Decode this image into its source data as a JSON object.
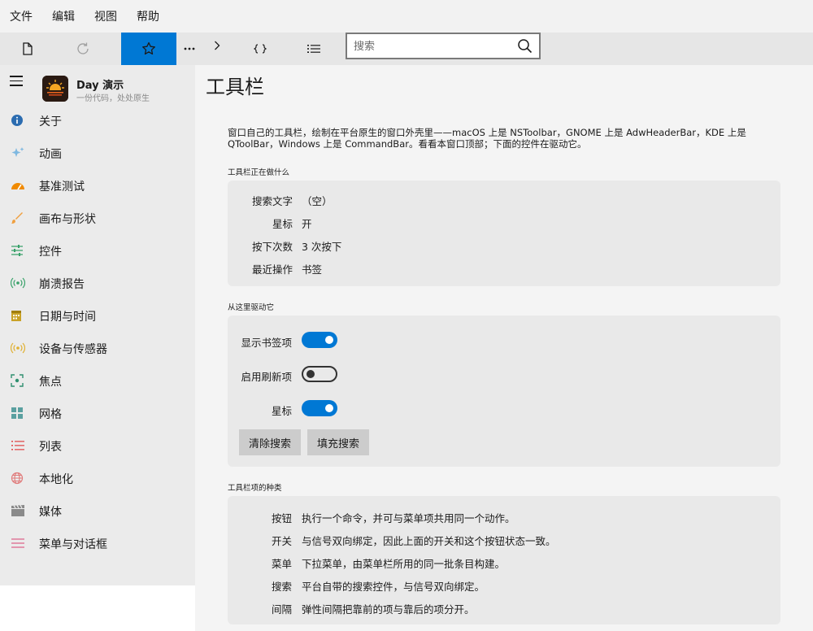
{
  "menu": [
    "文件",
    "编辑",
    "视图",
    "帮助"
  ],
  "search": {
    "placeholder": "搜索",
    "value": ""
  },
  "app": {
    "name": "Day 演示",
    "subtitle": "一份代码，处处原生"
  },
  "nav": [
    {
      "label": "关于",
      "icon": "info-icon",
      "color": "#2b6cb0"
    },
    {
      "label": "动画",
      "icon": "sparkle-icon",
      "color": "#7fb8e0"
    },
    {
      "label": "基准测试",
      "icon": "gauge-icon",
      "color": "#f08a00"
    },
    {
      "label": "画布与形状",
      "icon": "brush-icon",
      "color": "#f0a040"
    },
    {
      "label": "控件",
      "icon": "sliders-icon",
      "color": "#38a169"
    },
    {
      "label": "崩溃报告",
      "icon": "broadcast-icon",
      "color": "#38a169"
    },
    {
      "label": "日期与时间",
      "icon": "calendar-icon",
      "color": "#c9a227"
    },
    {
      "label": "设备与传感器",
      "icon": "sensor-icon",
      "color": "#e0b030"
    },
    {
      "label": "焦点",
      "icon": "focus-icon",
      "color": "#2f8f6f"
    },
    {
      "label": "网格",
      "icon": "grid-icon",
      "color": "#5aa0a0"
    },
    {
      "label": "列表",
      "icon": "list-icon",
      "color": "#e05050"
    },
    {
      "label": "本地化",
      "icon": "globe-icon",
      "color": "#e07a7a"
    },
    {
      "label": "媒体",
      "icon": "clapper-icon",
      "color": "#8a8a8a"
    },
    {
      "label": "菜单与对话框",
      "icon": "menu-lines-icon",
      "color": "#e07a9a"
    }
  ],
  "main": {
    "title": "工具栏",
    "desc": "窗口自己的工具栏，绘制在平台原生的窗口外壳里——macOS 上是 NSToolbar，GNOME 上是 AdwHeaderBar，KDE 上是 QToolBar，Windows 上是 CommandBar。看看本窗口顶部；下面的控件在驱动它。",
    "status_heading": "工具栏正在做什么",
    "status": [
      {
        "key": "搜索文字",
        "value": "（空）"
      },
      {
        "key": "星标",
        "value": "开"
      },
      {
        "key": "按下次数",
        "value": "3 次按下"
      },
      {
        "key": "最近操作",
        "value": "书签"
      }
    ],
    "drive_heading": "从这里驱动它",
    "toggles": [
      {
        "label": "显示书签项",
        "on": true
      },
      {
        "label": "启用刷新项",
        "on": false
      },
      {
        "label": "星标",
        "on": true
      }
    ],
    "buttons": {
      "clear": "清除搜索",
      "fill": "填充搜索"
    },
    "kinds_heading": "工具栏项的种类",
    "kinds": [
      {
        "key": "按钮",
        "value": "执行一个命令，并可与菜单项共用同一个动作。"
      },
      {
        "key": "开关",
        "value": "与信号双向绑定，因此上面的开关和这个按钮状态一致。"
      },
      {
        "key": "菜单",
        "value": "下拉菜单，由菜单栏所用的同一批条目构建。"
      },
      {
        "key": "搜索",
        "value": "平台自带的搜索控件，与信号双向绑定。"
      },
      {
        "key": "间隔",
        "value": "弹性间隔把靠前的项与靠后的项分开。"
      }
    ]
  },
  "colors": {
    "accent": "#0078d4"
  }
}
